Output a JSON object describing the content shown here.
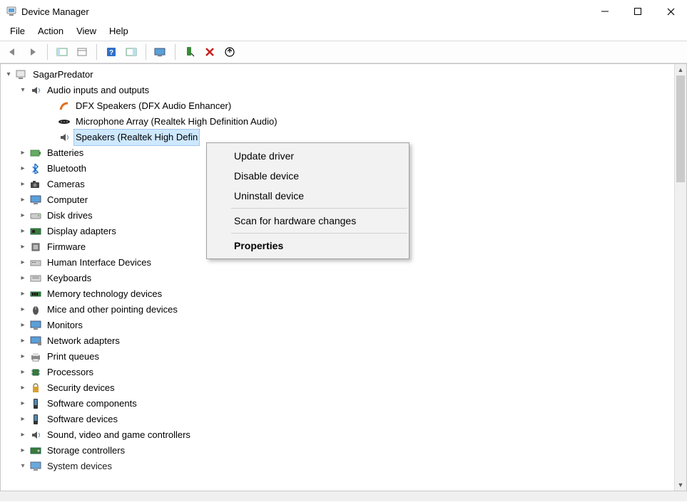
{
  "title": "Device Manager",
  "menus": [
    "File",
    "Action",
    "View",
    "Help"
  ],
  "context_menu": {
    "group1": [
      "Update driver",
      "Disable device",
      "Uninstall device"
    ],
    "group2": [
      "Scan for hardware changes"
    ],
    "group3": [
      "Properties"
    ]
  },
  "tree": {
    "root": "SagarPredator",
    "audio": {
      "label": "Audio inputs and outputs",
      "children": [
        "DFX Speakers (DFX Audio Enhancer)",
        "Microphone Array (Realtek High Definition Audio)",
        "Speakers (Realtek High Defin"
      ]
    },
    "categories": [
      "Batteries",
      "Bluetooth",
      "Cameras",
      "Computer",
      "Disk drives",
      "Display adapters",
      "Firmware",
      "Human Interface Devices",
      "Keyboards",
      "Memory technology devices",
      "Mice and other pointing devices",
      "Monitors",
      "Network adapters",
      "Print queues",
      "Processors",
      "Security devices",
      "Software components",
      "Software devices",
      "Sound, video and game controllers",
      "Storage controllers",
      "System devices"
    ]
  }
}
